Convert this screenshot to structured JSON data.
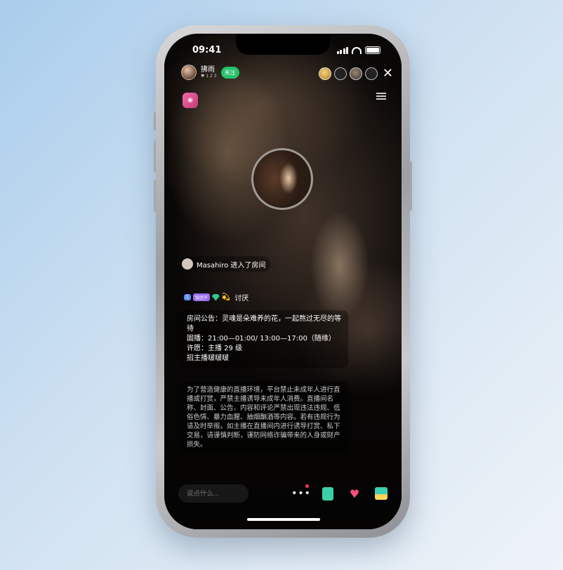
{
  "status_bar": {
    "time": "09:41"
  },
  "host": {
    "name": "拂雨",
    "sub": "♥ 1 2 3",
    "follow_label": "关注"
  },
  "rank_badge": "❀",
  "enter_message": "Masahiro 进入了房间",
  "chat": {
    "level_badge": "1",
    "fan_badge": "饭团子",
    "emoji": "💫",
    "text": "讨厌"
  },
  "announcement": {
    "lines": [
      "房间公告：灵魂是朵难养的花，一起熬过无尽的等待",
      "固播：21:00—01:00/ 13:00—17:00（随缘）",
      "许愿：主播 29 级",
      "招主播啵啵啵"
    ]
  },
  "notice": "为了营造健康的直播环境，平台禁止未成年人进行直播或打赏，严禁主播诱导未成年人消费。直播间名称、封面、公告、内容和评论严禁出现违法违规、低俗色情、暴力血腥、抽烟酗酒等内容。若有违规行为请及时举报。如主播在直播间内进行诱导打赏、私下交易，请谨慎判断，谨防网络诈骗带来的人身或财产损失。",
  "bottom_bar": {
    "input_placeholder": "说点什么..."
  },
  "icons": {
    "more": "more-dots-icon",
    "task": "task-icon",
    "like": "heart-icon",
    "gift": "gift-icon"
  },
  "colors": {
    "follow": "#27c16a",
    "heart": "#ff4f7a",
    "gift": "#3ad1b0"
  }
}
